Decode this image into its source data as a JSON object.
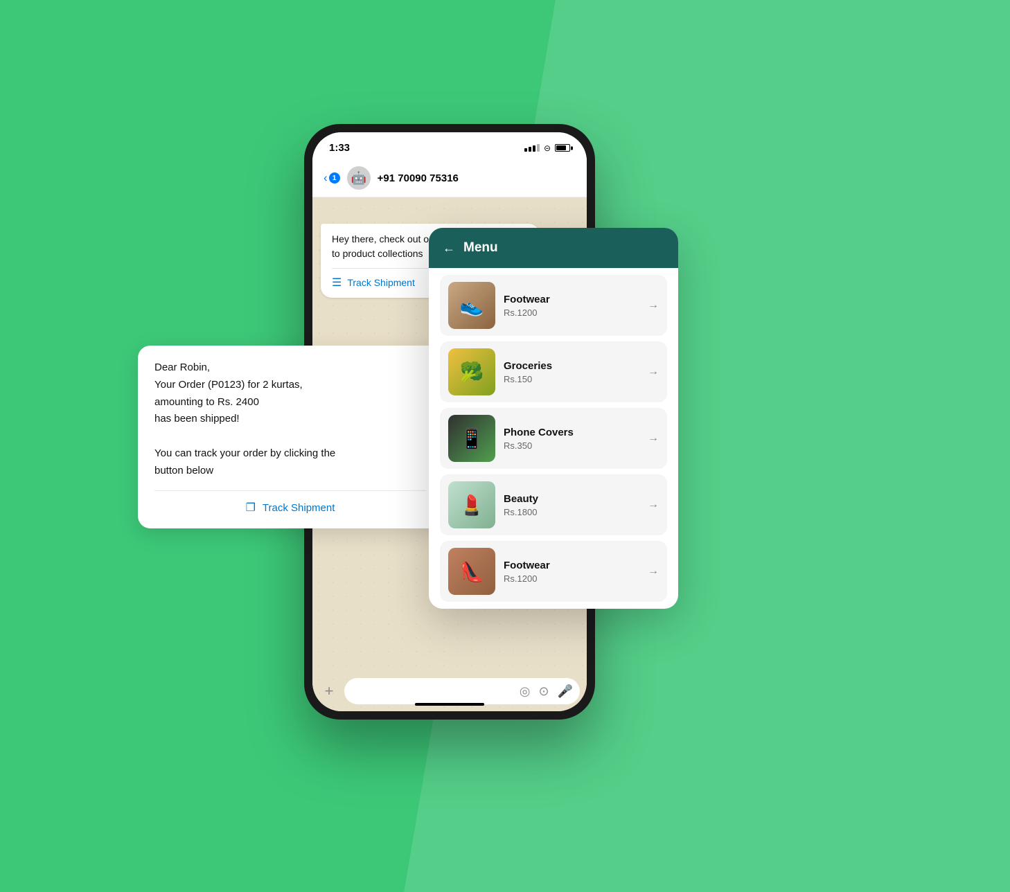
{
  "background": {
    "color": "#3dc878"
  },
  "status_bar": {
    "time": "1:33",
    "signal": "▌▌",
    "wifi": "wifi",
    "battery": "battery"
  },
  "wa_header": {
    "back_label": "1",
    "contact_name": "+91 70090 75316"
  },
  "first_bubble": {
    "text": "Hey there, check out our\nto product collections",
    "link_label": "Track Shipment"
  },
  "second_bubble": {
    "text_lines": [
      "Dear Robin,",
      "Your Order (P0123) for 2 kurtas,",
      "amounting to Rs. 2400",
      "has been shipped!",
      "",
      "You can track your order by clicking the",
      "button below"
    ],
    "link_label": "Track Shipment"
  },
  "menu": {
    "back_label": "←",
    "title": "Menu",
    "items": [
      {
        "name": "Footwear",
        "price": "Rs.1200",
        "emoji": "👟"
      },
      {
        "name": "Groceries",
        "price": "Rs.150",
        "emoji": "🥦"
      },
      {
        "name": "Phone Covers",
        "price": "Rs.350",
        "emoji": "📱"
      },
      {
        "name": "Beauty",
        "price": "Rs.1800",
        "emoji": "💄"
      },
      {
        "name": "Footwear",
        "price": "Rs.1200",
        "emoji": "👠"
      }
    ]
  },
  "chat_bottom": {
    "plus": "+",
    "sticker": "◎",
    "camera": "⊙",
    "mic": "🎤"
  }
}
